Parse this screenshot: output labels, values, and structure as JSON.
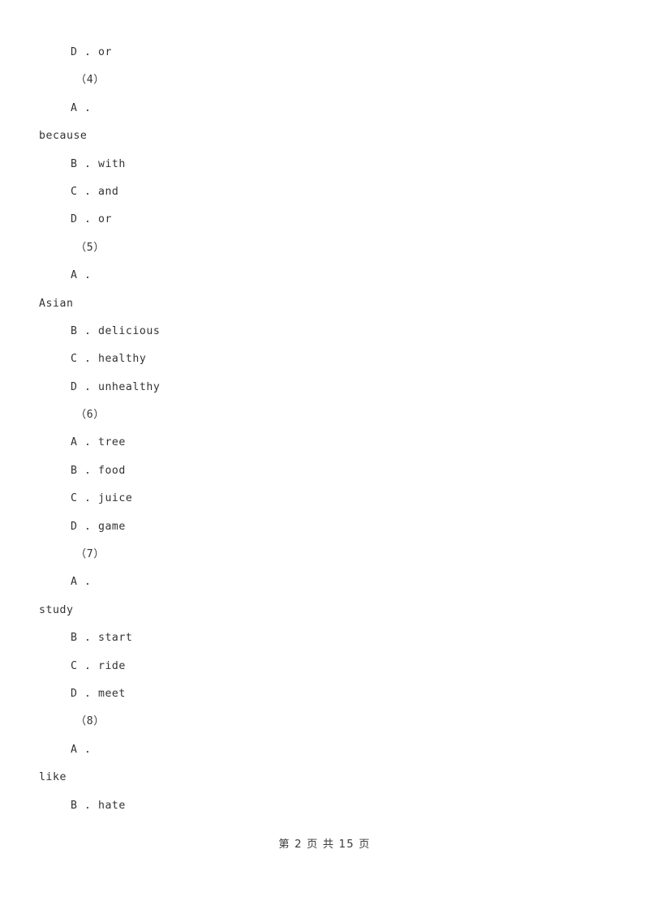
{
  "document": {
    "type": "exam-paper-page",
    "page_number": 2,
    "total_pages": 15,
    "footer_text": "第 2 页 共 15 页",
    "background_color": "#ffffff",
    "text_color": "#333333"
  },
  "lines": [
    {
      "id": "l1",
      "text": "D . or",
      "style": "opt"
    },
    {
      "id": "l2",
      "text": "（4）",
      "style": "qnum"
    },
    {
      "id": "l3",
      "text": "A .",
      "style": "opt"
    },
    {
      "id": "l4",
      "text": "because",
      "style": "flush"
    },
    {
      "id": "l5",
      "text": "B . with",
      "style": "opt"
    },
    {
      "id": "l6",
      "text": "C . and",
      "style": "opt"
    },
    {
      "id": "l7",
      "text": "D . or",
      "style": "opt"
    },
    {
      "id": "l8",
      "text": "（5）",
      "style": "qnum"
    },
    {
      "id": "l9",
      "text": "A .",
      "style": "opt"
    },
    {
      "id": "l10",
      "text": "Asian",
      "style": "flush"
    },
    {
      "id": "l11",
      "text": "B . delicious",
      "style": "opt"
    },
    {
      "id": "l12",
      "text": "C . healthy",
      "style": "opt"
    },
    {
      "id": "l13",
      "text": "D . unhealthy",
      "style": "opt"
    },
    {
      "id": "l14",
      "text": "（6）",
      "style": "qnum"
    },
    {
      "id": "l15",
      "text": "A . tree",
      "style": "opt"
    },
    {
      "id": "l16",
      "text": "B . food",
      "style": "opt"
    },
    {
      "id": "l17",
      "text": "C . juice",
      "style": "opt"
    },
    {
      "id": "l18",
      "text": "D . game",
      "style": "opt"
    },
    {
      "id": "l19",
      "text": "（7）",
      "style": "qnum"
    },
    {
      "id": "l20",
      "text": "A .",
      "style": "opt"
    },
    {
      "id": "l21",
      "text": "study",
      "style": "flush"
    },
    {
      "id": "l22",
      "text": "B . start",
      "style": "opt"
    },
    {
      "id": "l23",
      "text": "C . ride",
      "style": "opt"
    },
    {
      "id": "l24",
      "text": "D . meet",
      "style": "opt"
    },
    {
      "id": "l25",
      "text": "（8）",
      "style": "qnum"
    },
    {
      "id": "l26",
      "text": "A .",
      "style": "opt"
    },
    {
      "id": "l27",
      "text": "like",
      "style": "flush"
    },
    {
      "id": "l28",
      "text": "B . hate",
      "style": "opt"
    }
  ]
}
